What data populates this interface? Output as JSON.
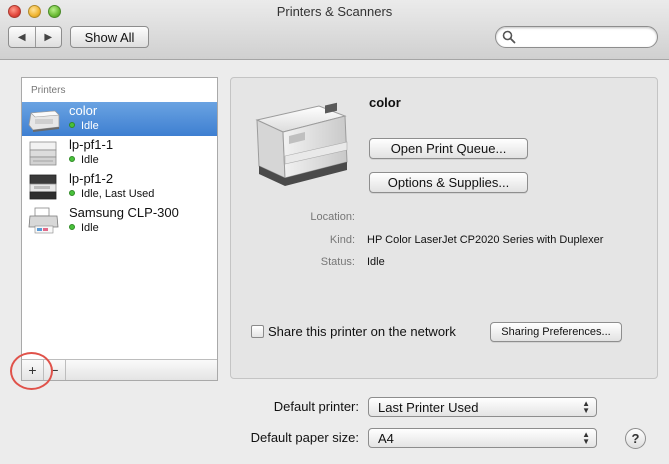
{
  "window": {
    "title": "Printers & Scanners"
  },
  "toolbar": {
    "back_glyph": "◀",
    "forward_glyph": "▶",
    "show_all_label": "Show All",
    "search_value": ""
  },
  "printers": {
    "header": "Printers",
    "items": [
      {
        "name": "color",
        "status": "Idle",
        "selected": true
      },
      {
        "name": "lp-pf1-1",
        "status": "Idle",
        "selected": false
      },
      {
        "name": "lp-pf1-2",
        "status": "Idle, Last Used",
        "selected": false
      },
      {
        "name": "Samsung CLP-300",
        "status": "Idle",
        "selected": false
      }
    ],
    "add_label": "+",
    "remove_label": "−"
  },
  "detail": {
    "name": "color",
    "open_queue_label": "Open Print Queue...",
    "options_label": "Options & Supplies...",
    "location_label": "Location:",
    "location_value": "",
    "kind_label": "Kind:",
    "kind_value": "HP Color LaserJet CP2020 Series with Duplexer",
    "status_label": "Status:",
    "status_value": "Idle",
    "share_label": "Share this printer on the network",
    "share_checked": false,
    "sharing_prefs_label": "Sharing Preferences..."
  },
  "defaults": {
    "printer_label": "Default printer:",
    "printer_value": "Last Printer Used",
    "paper_label": "Default paper size:",
    "paper_value": "A4"
  },
  "help_label": "?",
  "colors": {
    "selection": "#3e7fd1",
    "status_ok": "#49c13b",
    "highlight_ring": "#e0524a"
  }
}
